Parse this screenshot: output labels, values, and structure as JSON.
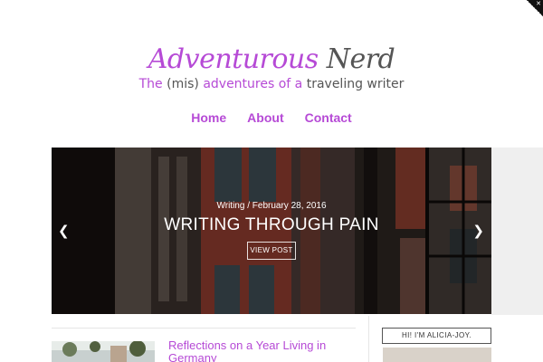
{
  "site": {
    "title_part1": "Adventurous",
    "title_part2": "Nerd",
    "tagline": {
      "t1": "The",
      "t2": "(mis)",
      "t3": "adventures of a",
      "t4": "traveling",
      "t5": "writer"
    }
  },
  "nav": {
    "items": [
      {
        "label": "Home"
      },
      {
        "label": "About"
      },
      {
        "label": "Contact"
      }
    ]
  },
  "slider": {
    "category": "Writing",
    "separator": " / ",
    "date": "February 28, 2016",
    "title": "WRITING THROUGH PAIN",
    "button_label": "VIEW POST",
    "prev_icon": "chevron-left-icon",
    "next_icon": "chevron-right-icon"
  },
  "posts": [
    {
      "title": "Reflections on a Year Living in Germany"
    }
  ],
  "sidebar": {
    "widget_title": "HI! I'M ALICIA-JOY."
  },
  "colors": {
    "accent": "#b64ad6",
    "text_dark": "#555555"
  }
}
